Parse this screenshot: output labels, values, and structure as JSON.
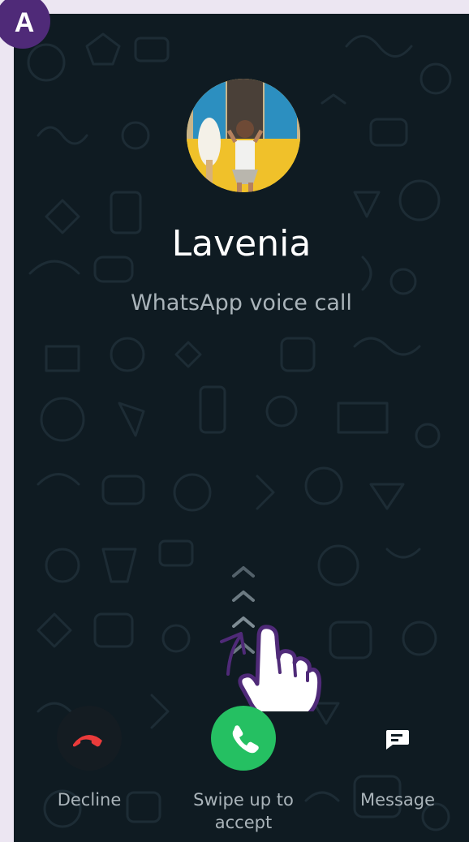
{
  "badge": {
    "letter": "A"
  },
  "caller": {
    "name": "Lavenia",
    "avatar": "profile-photo"
  },
  "call": {
    "type_label": "WhatsApp voice call"
  },
  "actions": {
    "decline": {
      "label": "Decline",
      "icon": "phone-hangup-icon",
      "color": "#ea3b3b"
    },
    "accept": {
      "label_line1": "Swipe up to",
      "label_line2": "accept",
      "icon": "phone-icon",
      "color": "#25c062"
    },
    "message": {
      "label": "Message",
      "icon": "message-icon"
    }
  },
  "colors": {
    "background": "#0f1b22",
    "accent": "#25c062",
    "decline": "#ea3b3b",
    "annotation": "#4f2a78"
  }
}
